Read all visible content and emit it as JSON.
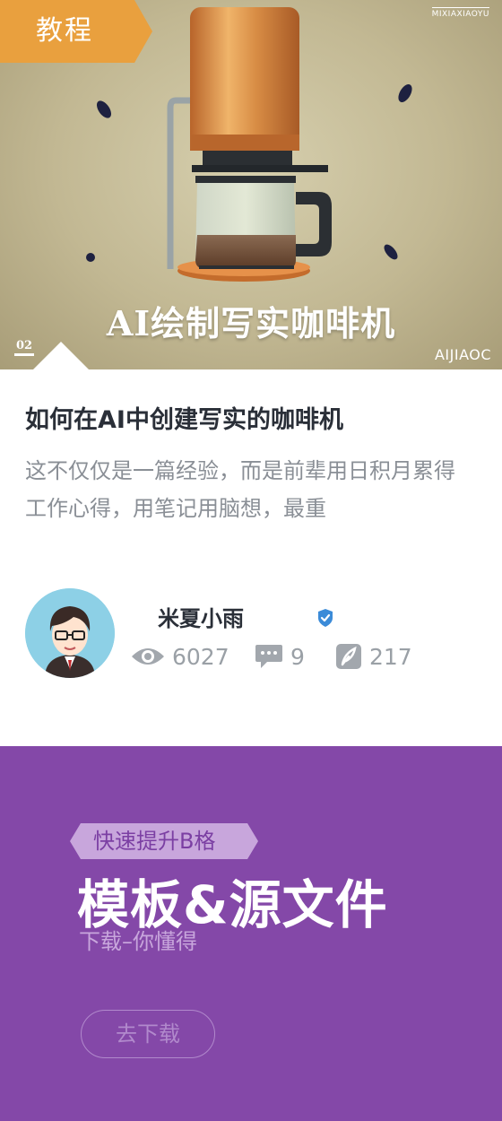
{
  "hero": {
    "tag_label": "教程",
    "brand_top": "MIXIAXIAOYU",
    "title": "AI绘制写实咖啡机",
    "number": "02",
    "brand_bottom": "AIJIAOC"
  },
  "article": {
    "title": "如何在AI中创建写实的咖啡机",
    "excerpt": "这不仅仅是一篇经验，而是前辈用日积月累得工作心得，用笔记用脑想，最重"
  },
  "author": {
    "name": "米夏小雨",
    "verified_icon": "verified-check-icon"
  },
  "stats": {
    "views": "6027",
    "comments": "9",
    "likes": "217",
    "icons": [
      "eye-icon",
      "comment-icon",
      "feather-icon"
    ]
  },
  "promo": {
    "ribbon": "快速提升B格",
    "title": "模板&源文件",
    "subtitle": "下载–你懂得",
    "button": "去下载"
  },
  "colors": {
    "tag": "#e9a03e",
    "promo_bg": "#8448a8",
    "verify": "#3b8bd8"
  }
}
